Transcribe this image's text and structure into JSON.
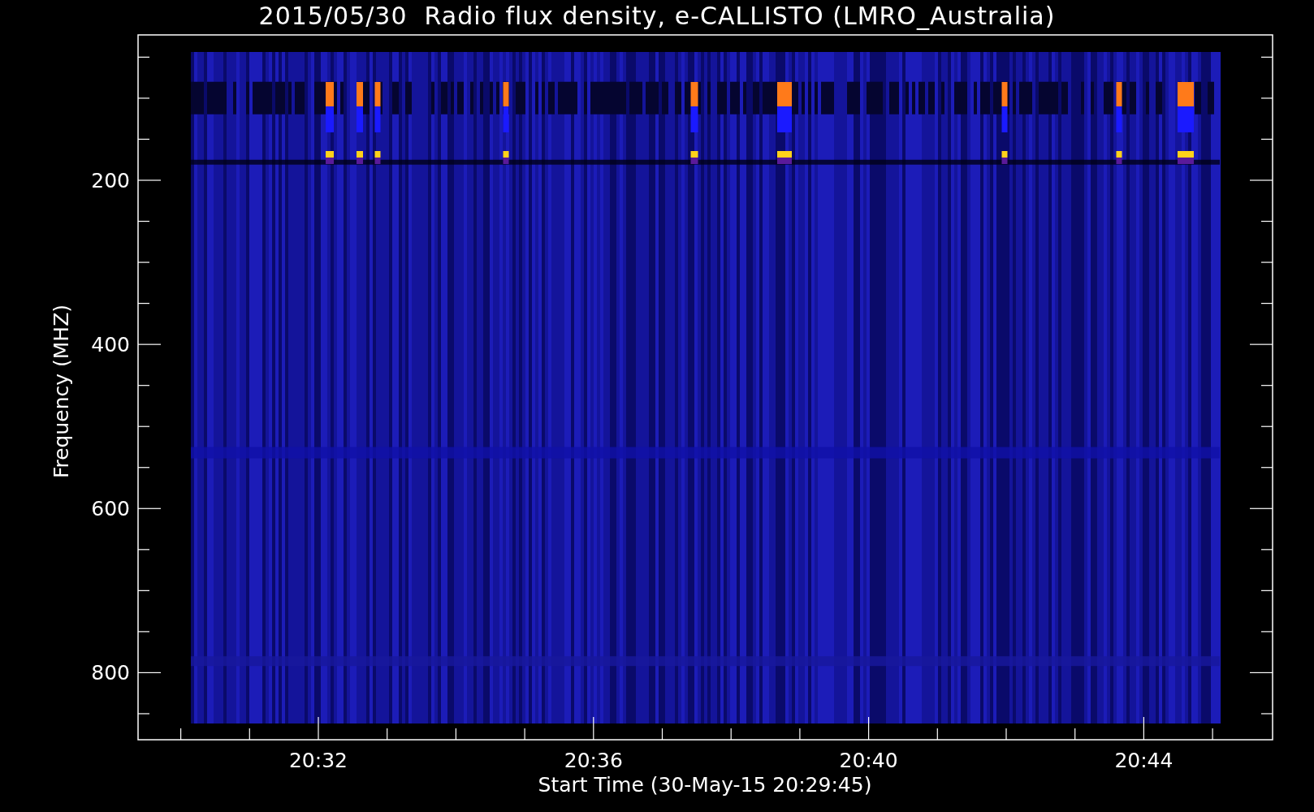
{
  "title": "2015/05/30  Radio flux density, e-CALLISTO (LMRO_Australia)",
  "y_axis": {
    "label": "Frequency (MHZ)",
    "ticks": [
      "200",
      "400",
      "600",
      "800"
    ]
  },
  "x_axis": {
    "label": "Start Time (30-May-15 20:29:45)",
    "ticks": [
      "20:32",
      "20:36",
      "20:40",
      "20:44"
    ]
  }
}
